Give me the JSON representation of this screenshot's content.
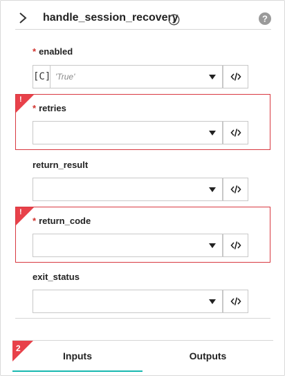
{
  "header": {
    "title": "handle_session_recovery",
    "chevron_icon": "chevron-right-icon",
    "info_icon": "info-circle-icon",
    "help_icon": "question-circle-icon"
  },
  "required_marker": "*",
  "error_marker": "!",
  "fields": {
    "enabled": {
      "label": "enabled",
      "required": true,
      "prefix": "[C]",
      "value": "'True'"
    },
    "retries": {
      "label": "retries",
      "required": true,
      "error": true,
      "value": ""
    },
    "return_result": {
      "label": "return_result",
      "required": false,
      "value": ""
    },
    "return_code": {
      "label": "return_code",
      "required": true,
      "error": true,
      "value": ""
    },
    "exit_status": {
      "label": "exit_status",
      "required": false,
      "value": ""
    }
  },
  "expression_icon": "code-brackets-icon",
  "tabs": {
    "inputs": {
      "label": "Inputs",
      "badge": "2",
      "active": true
    },
    "outputs": {
      "label": "Outputs",
      "active": false
    }
  },
  "colors": {
    "error": "#d8373f",
    "badge": "#e8414a",
    "active_tab": "#17b8b0"
  }
}
